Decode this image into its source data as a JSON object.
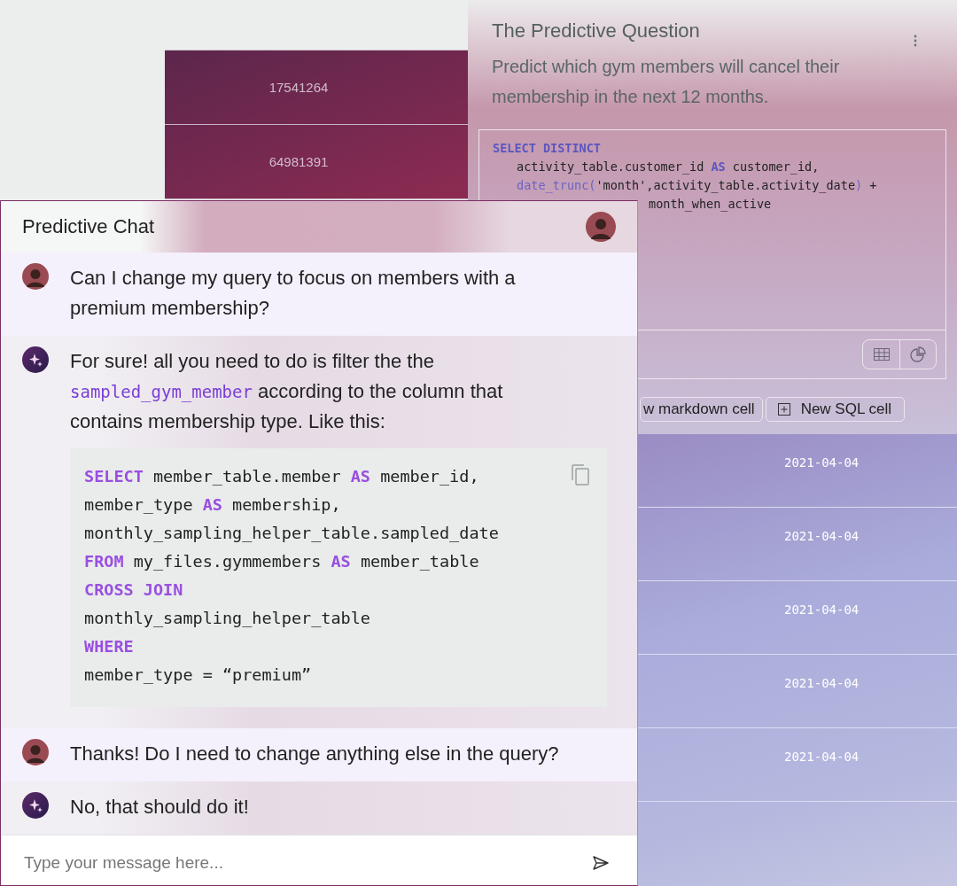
{
  "back_table": {
    "rows": [
      "17541264",
      "64981391"
    ]
  },
  "notebook": {
    "title": "The Predictive Question",
    "description": "Predict which gym members will cancel their membership in the next 12 months.",
    "code_lines": [
      {
        "kind": "plain",
        "tokens": [
          {
            "kind": "kw",
            "text": "SELECT DISTINCT"
          }
        ]
      },
      {
        "kind": "indented",
        "tokens": [
          {
            "kind": "txt",
            "text": "activity_table.customer_id "
          },
          {
            "kind": "kw",
            "text": "AS"
          },
          {
            "kind": "txt",
            "text": " customer_id,"
          }
        ]
      },
      {
        "kind": "indented",
        "tokens": [
          {
            "kind": "fn",
            "text": "date_trunc("
          },
          {
            "kind": "txt",
            "text": "'month',activity_table.activity_date"
          },
          {
            "kind": "fn",
            "text": ")"
          },
          {
            "kind": "txt",
            "text": " +"
          }
        ]
      },
      {
        "kind": "covered",
        "tokens": [
          {
            "kind": "txt",
            "text": "month_when_active"
          }
        ]
      }
    ],
    "view_toggles": [
      {
        "kind": "table",
        "selected": false
      },
      {
        "kind": "chart",
        "selected": false
      }
    ],
    "buttons": [
      {
        "kind": "markdown",
        "label": "w markdown cell"
      },
      {
        "kind": "sql",
        "label": "New SQL cell"
      }
    ],
    "dates": [
      "2021-04-04",
      "2021-04-04",
      "2021-04-04",
      "2021-04-04",
      "2021-04-04"
    ]
  },
  "chat": {
    "title": "Predictive Chat",
    "messages": [
      {
        "kind": "user",
        "parts": [
          {
            "kind": "text",
            "text": "Can I change my query to focus on members with a premium membership?"
          }
        ]
      },
      {
        "kind": "bot",
        "parts": [
          {
            "kind": "text",
            "text": "For sure! all you need to do is filter the the "
          },
          {
            "kind": "code",
            "text": "sampled_gym_member"
          },
          {
            "kind": "text",
            "text": " according to the column that contains membership type. Like this:"
          }
        ],
        "code_block": [
          [
            {
              "kind": "kw",
              "text": "SELECT"
            },
            {
              "kind": "txt",
              "text": " member_table.member "
            },
            {
              "kind": "kw",
              "text": "AS"
            },
            {
              "kind": "txt",
              "text": " member_id,"
            }
          ],
          [
            {
              "kind": "txt",
              "text": "member_type "
            },
            {
              "kind": "kw",
              "text": "AS"
            },
            {
              "kind": "txt",
              "text": " membership,"
            }
          ],
          [
            {
              "kind": "txt",
              "text": "monthly_sampling_helper_table.sampled_date"
            }
          ],
          [
            {
              "kind": "kw",
              "text": "FROM"
            },
            {
              "kind": "txt",
              "text": " my_files.gymmembers "
            },
            {
              "kind": "kw",
              "text": "AS"
            },
            {
              "kind": "txt",
              "text": " member_table"
            }
          ],
          [
            {
              "kind": "kw",
              "text": "CROSS JOIN"
            }
          ],
          [
            {
              "kind": "txt",
              "text": "monthly_sampling_helper_table"
            }
          ],
          [
            {
              "kind": "kw",
              "text": "WHERE"
            }
          ],
          [
            {
              "kind": "txt",
              "text": "member_type = “premium”"
            }
          ]
        ]
      },
      {
        "kind": "user",
        "parts": [
          {
            "kind": "text",
            "text": "Thanks! Do I need to change anything else in the query?"
          }
        ]
      },
      {
        "kind": "bot",
        "parts": [
          {
            "kind": "text",
            "text": "No, that should do it!"
          }
        ]
      }
    ],
    "input": {
      "placeholder": "Type your message here..."
    }
  }
}
